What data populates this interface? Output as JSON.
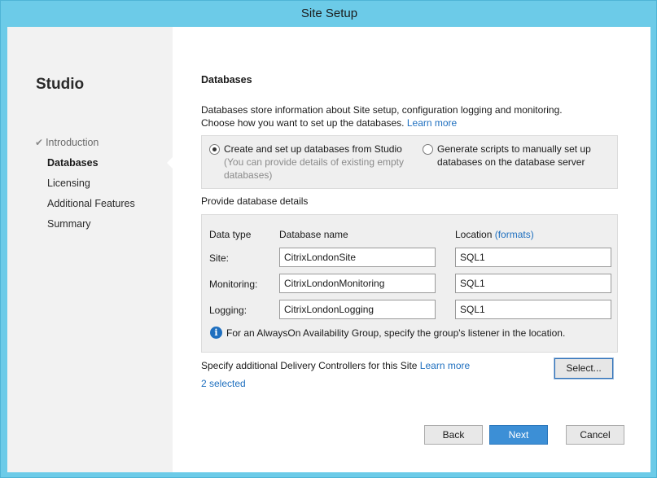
{
  "window": {
    "title": "Site Setup"
  },
  "sidebar": {
    "title": "Studio",
    "items": [
      {
        "label": "Introduction",
        "state": "done"
      },
      {
        "label": "Databases",
        "state": "active"
      },
      {
        "label": "Licensing",
        "state": "pending"
      },
      {
        "label": "Additional Features",
        "state": "pending"
      },
      {
        "label": "Summary",
        "state": "pending"
      }
    ]
  },
  "page": {
    "title": "Databases",
    "description_line1": "Databases store information about Site setup, configuration logging and monitoring.",
    "description_line2": "Choose how you want to set up the databases.",
    "learn_more": "Learn more"
  },
  "setup_options": {
    "option1_label": "Create and set up databases from Studio",
    "option1_sub_line1": "(You can provide details of existing empty",
    "option1_sub_line2": "databases)",
    "option1_checked": true,
    "option2_line1": "Generate scripts to manually set up",
    "option2_line2": "databases on the database server",
    "option2_checked": false
  },
  "database_details": {
    "section_label": "Provide database details",
    "col_data_type": "Data type",
    "col_database_name": "Database name",
    "col_location": "Location",
    "col_location_link": "(formats)",
    "rows": [
      {
        "label": "Site:",
        "name": "CitrixLondonSite",
        "location": "SQL1"
      },
      {
        "label": "Monitoring:",
        "name": "CitrixLondonMonitoring",
        "location": "SQL1"
      },
      {
        "label": "Logging:",
        "name": "CitrixLondonLogging",
        "location": "SQL1"
      }
    ],
    "info_text": "For an AlwaysOn Availability Group, specify the group's listener in the location."
  },
  "controllers": {
    "label": "Specify additional Delivery Controllers for this Site",
    "learn_more": "Learn more",
    "selected": "2 selected",
    "select_button": "Select..."
  },
  "footer": {
    "back": "Back",
    "next": "Next",
    "cancel": "Cancel"
  },
  "colors": {
    "title_bar": "#6ccbe8",
    "link": "#1e6fbf",
    "primary_button": "#3c8fd6"
  }
}
